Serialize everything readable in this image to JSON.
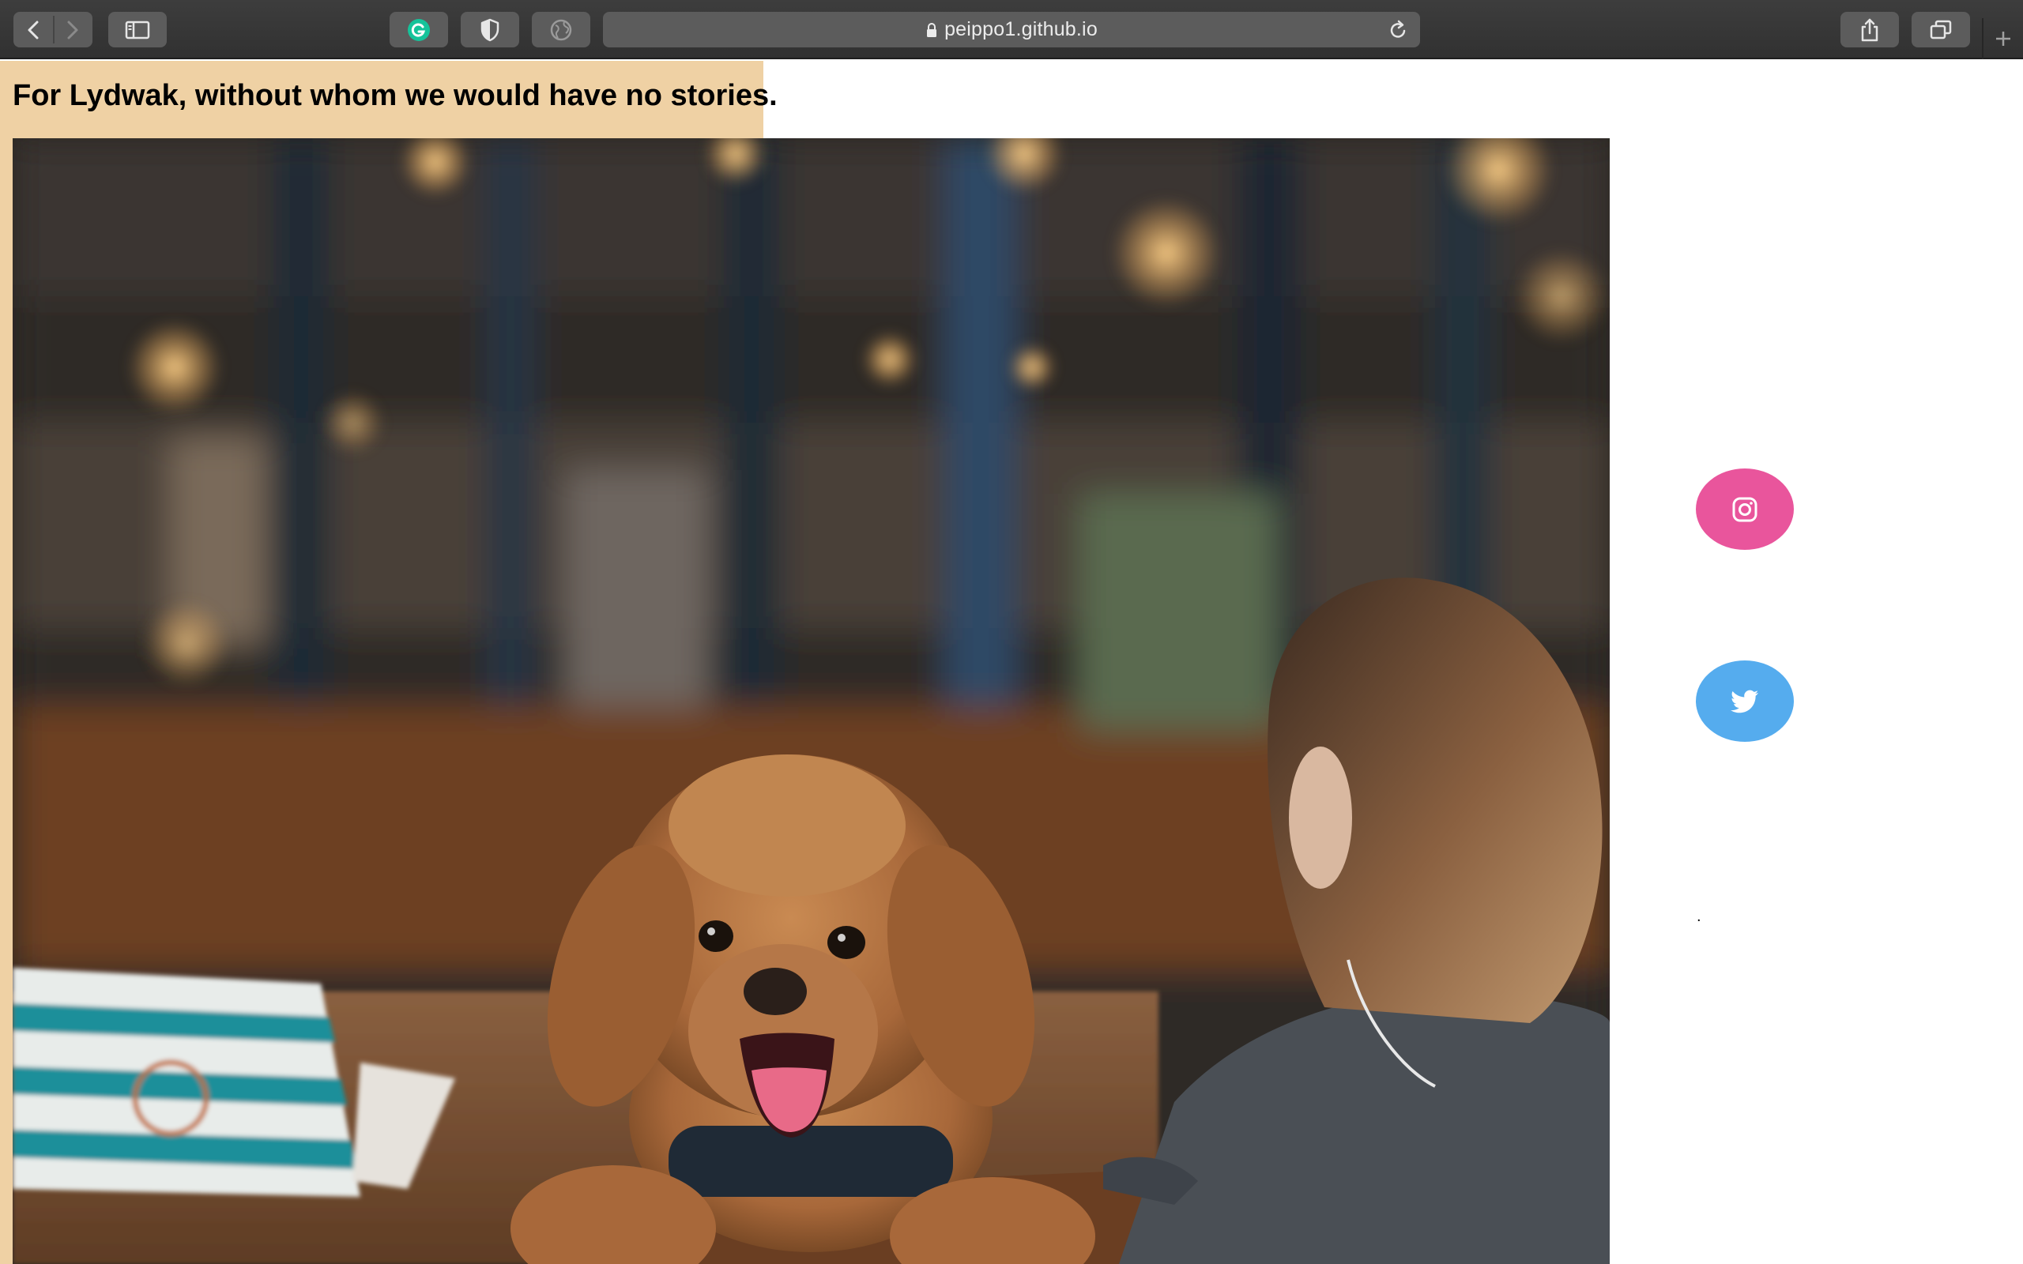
{
  "browser": {
    "url": "peippo1.github.io",
    "icons": {
      "back": "chevron-left-icon",
      "forward": "chevron-right-icon",
      "sidebar": "sidebar-icon",
      "grammarly": "grammarly-icon",
      "shield": "shield-icon",
      "globe": "globe-icon",
      "lock": "lock-icon",
      "reload": "reload-icon",
      "share": "share-icon",
      "tabs": "tabs-icon",
      "new_tab": "plus-icon"
    }
  },
  "page": {
    "heading": "For Lydwak, without whom we would have no stories.",
    "dot": ".",
    "social": {
      "instagram": {
        "icon": "instagram-icon",
        "color": "#e9559c"
      },
      "twitter": {
        "icon": "twitter-icon",
        "color": "#55acee"
      }
    },
    "colors": {
      "tan": "#efd1a4"
    }
  }
}
